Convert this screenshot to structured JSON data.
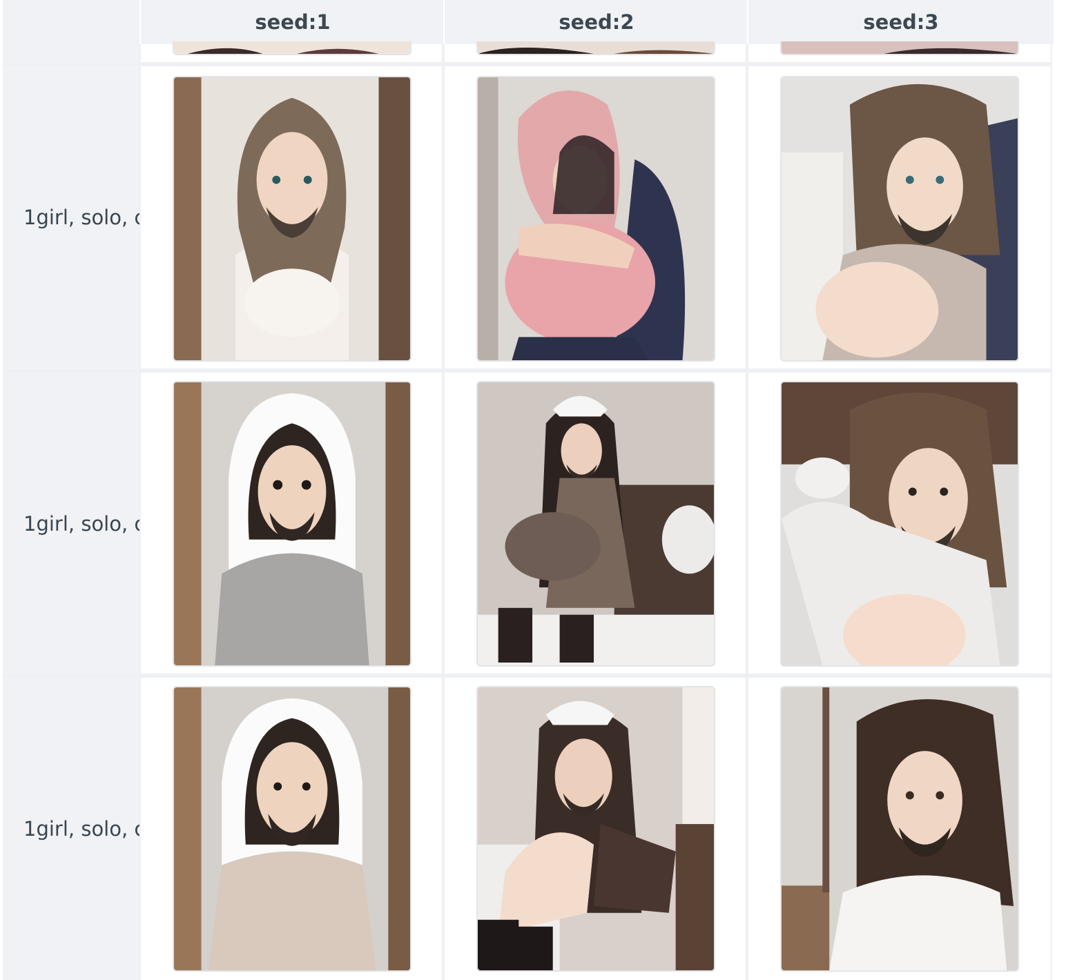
{
  "columns": [
    {
      "label": ""
    },
    {
      "label": "seed:1"
    },
    {
      "label": "seed:2"
    },
    {
      "label": "seed:3"
    }
  ],
  "rows": [
    {
      "prompt_label": "1girl, solo, c",
      "images": [
        {
          "alt": "anime character long hair beard white shirt doorway"
        },
        {
          "alt": "anime character hugging pink plush pillow"
        },
        {
          "alt": "anime character long hair beard grey shirt bed"
        }
      ]
    },
    {
      "prompt_label": "1girl, solo, c",
      "images": [
        {
          "alt": "anime character white hood beard grey shirt doorway"
        },
        {
          "alt": "anime character headscarf brown outfit sitting on bed"
        },
        {
          "alt": "anime character long hair beard white shirt on bed"
        }
      ]
    },
    {
      "prompt_label": "1girl, solo, c",
      "images": [
        {
          "alt": "anime character white hood beard beige shirt doorway"
        },
        {
          "alt": "anime character headscarf sitting hugging knees"
        },
        {
          "alt": "anime character long hair beard white shirt room"
        }
      ]
    }
  ],
  "colors": {
    "header_bg": "#f0f2f5",
    "label_bg": "#f0f2f5",
    "border": "#eef0f3",
    "text": "#3c4852"
  }
}
